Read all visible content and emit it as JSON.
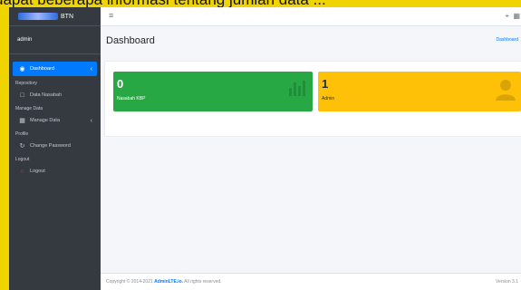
{
  "caption": "dapat beberapa informasi tentang jumlah data ...",
  "brand": {
    "text": "BTN"
  },
  "user": {
    "name": "admin"
  },
  "sidebar": {
    "dashboard": "Dashboard",
    "repository_header": "Repository",
    "data_nasabah": "Data Nasabah",
    "manage_header": "Manage Data",
    "manage_data": "Manage Data",
    "profile_header": "Profile",
    "change_password": "Change Password",
    "logout_header": "Logout",
    "logout": "Logout"
  },
  "topbar": {
    "menu_icon": "hamburger-icon",
    "expand_icon": "fullscreen-icon",
    "grid_icon": "grid-icon"
  },
  "header": {
    "title": "Dashboard",
    "breadcrumb": "Dashboard"
  },
  "boxes": [
    {
      "value": "0",
      "label": "Nasabah KBP",
      "color": "#28a745",
      "icon": "chart-bar-icon"
    },
    {
      "value": "1",
      "label": "Admin",
      "color": "#ffc107",
      "icon": "user-icon"
    }
  ],
  "footer": {
    "prefix": "Copyright © 2014-2021",
    "link": "AdminLTE.io.",
    "suffix": " All rights reserved.",
    "version": "Version 3.1"
  },
  "colors": {
    "sidebar": "#343a40",
    "accent": "#007bff",
    "success": "#28a745",
    "warning": "#ffc107",
    "background_stripe": "#f0d400"
  }
}
